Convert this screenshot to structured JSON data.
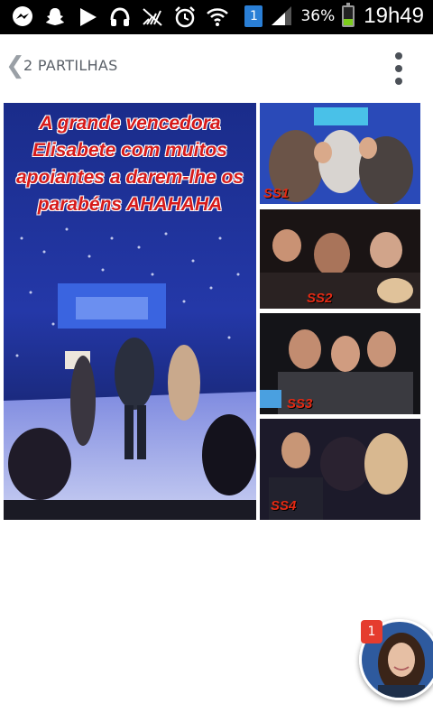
{
  "status_bar": {
    "icons": [
      "messenger-icon",
      "snapchat-icon",
      "play-icon",
      "headphones-icon",
      "no-signal-icon",
      "alarm-icon",
      "wifi-icon"
    ],
    "notification_badge": "1",
    "battery_percent": "36%",
    "battery_level": 0.36,
    "time": "19h49"
  },
  "header": {
    "back_glyph": "❮",
    "title": "2 PARTILHAS"
  },
  "collage": {
    "main_caption": "A grande vencedora Elisabete com muitos apoiantes a darem-lhe os parabéns AHAHAHA",
    "thumbs": [
      {
        "label": "SS1"
      },
      {
        "label": "SS2"
      },
      {
        "label": "SS3"
      },
      {
        "label": "SS4"
      }
    ]
  },
  "chat_head": {
    "badge": "1"
  },
  "colors": {
    "accent_badge": "#2a7fd6",
    "chat_badge": "#e53c2e",
    "caption_red": "#d61a1a"
  }
}
